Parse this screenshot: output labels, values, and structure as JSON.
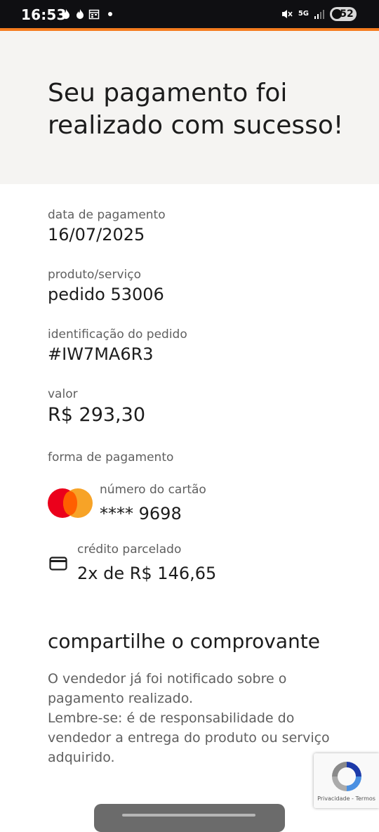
{
  "status_bar": {
    "time": "16:53",
    "network": "5G",
    "battery": "52",
    "icons": [
      "flame-icon",
      "flame-icon",
      "calendar-icon",
      "dot-icon",
      "mute-icon",
      "5g-icon",
      "signal-icon",
      "battery-icon"
    ]
  },
  "colors": {
    "accent": "#f57c1f",
    "hero_background": "#f5f4f2",
    "mastercard_red": "#eb001b",
    "mastercard_yellow": "#f79e1b"
  },
  "hero": {
    "title": "Seu pagamento foi realizado com sucesso!"
  },
  "details": {
    "payment_date": {
      "label": "data de pagamento",
      "value": "16/07/2025"
    },
    "product": {
      "label": "produto/serviço",
      "value": "pedido 53006"
    },
    "order_id": {
      "label": "identificação do pedido",
      "value": "#IW7MA6R3"
    },
    "amount": {
      "label": "valor",
      "value": "R$ 293,30"
    }
  },
  "payment_method": {
    "label": "forma de pagamento",
    "card_label": "número do cartão",
    "card_number": "**** 9698",
    "installment_label": "crédito parcelado",
    "installment_value": "2x de R$ 146,65"
  },
  "share": {
    "title": "compartilhe o comprovante",
    "line1": "O vendedor já foi notificado sobre o pagamento realizado.",
    "line2": "Lembre-se: é de responsabilidade do vendedor a entrega do produto ou serviço adquirido."
  },
  "recaptcha": {
    "links": "Privacidade - Termos"
  }
}
